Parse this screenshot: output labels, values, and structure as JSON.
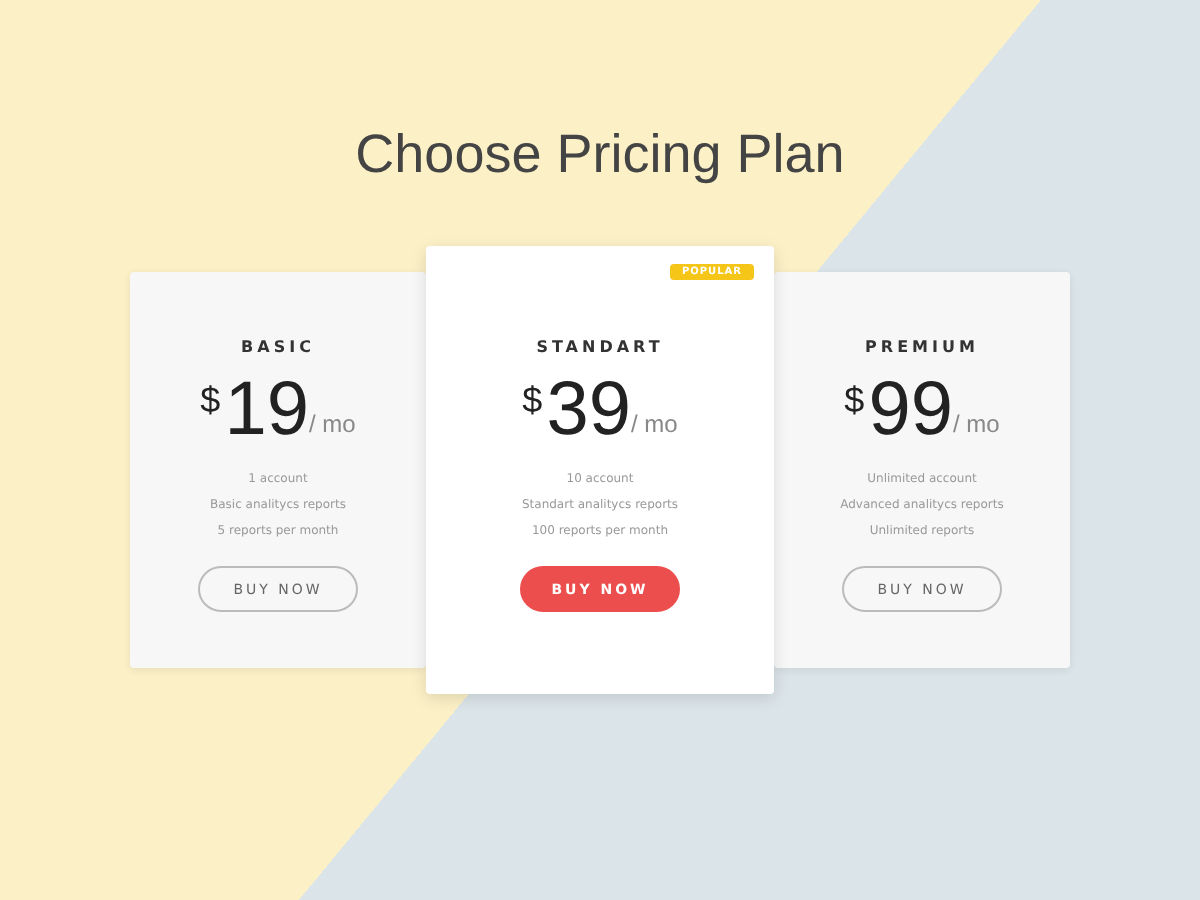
{
  "title": "Choose Pricing Plan",
  "plans": [
    {
      "name": "BASIC",
      "currency": "$",
      "price": "19",
      "period": "/ mo",
      "features": [
        "1 account",
        "Basic analitycs reports",
        "5 reports per month"
      ],
      "button": "BUY NOW",
      "featured": false
    },
    {
      "name": "STANDART",
      "currency": "$",
      "price": "39",
      "period": "/ mo",
      "features": [
        "10 account",
        "Standart analitycs reports",
        "100 reports per month"
      ],
      "button": "BUY NOW",
      "featured": true,
      "badge": "POPULAR"
    },
    {
      "name": "PREMIUM",
      "currency": "$",
      "price": "99",
      "period": "/ mo",
      "features": [
        "Unlimited account",
        "Advanced analitycs reports",
        "Unlimited reports"
      ],
      "button": "BUY NOW",
      "featured": false
    }
  ]
}
